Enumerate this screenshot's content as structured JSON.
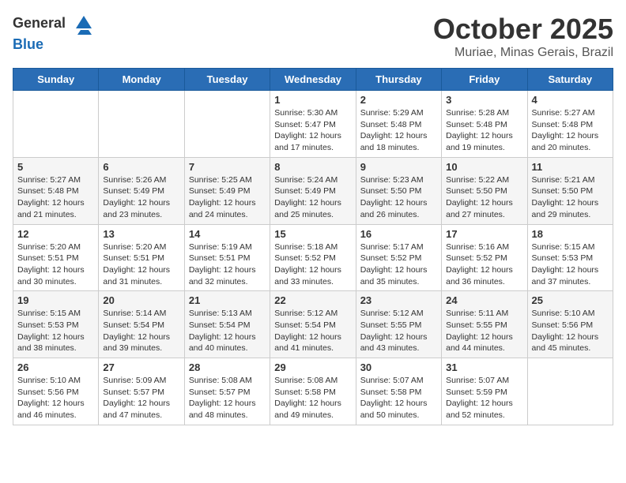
{
  "logo": {
    "general": "General",
    "blue": "Blue"
  },
  "title": "October 2025",
  "location": "Muriae, Minas Gerais, Brazil",
  "days_of_week": [
    "Sunday",
    "Monday",
    "Tuesday",
    "Wednesday",
    "Thursday",
    "Friday",
    "Saturday"
  ],
  "weeks": [
    [
      {
        "day": "",
        "info": ""
      },
      {
        "day": "",
        "info": ""
      },
      {
        "day": "",
        "info": ""
      },
      {
        "day": "1",
        "info": "Sunrise: 5:30 AM\nSunset: 5:47 PM\nDaylight: 12 hours\nand 17 minutes."
      },
      {
        "day": "2",
        "info": "Sunrise: 5:29 AM\nSunset: 5:48 PM\nDaylight: 12 hours\nand 18 minutes."
      },
      {
        "day": "3",
        "info": "Sunrise: 5:28 AM\nSunset: 5:48 PM\nDaylight: 12 hours\nand 19 minutes."
      },
      {
        "day": "4",
        "info": "Sunrise: 5:27 AM\nSunset: 5:48 PM\nDaylight: 12 hours\nand 20 minutes."
      }
    ],
    [
      {
        "day": "5",
        "info": "Sunrise: 5:27 AM\nSunset: 5:48 PM\nDaylight: 12 hours\nand 21 minutes."
      },
      {
        "day": "6",
        "info": "Sunrise: 5:26 AM\nSunset: 5:49 PM\nDaylight: 12 hours\nand 23 minutes."
      },
      {
        "day": "7",
        "info": "Sunrise: 5:25 AM\nSunset: 5:49 PM\nDaylight: 12 hours\nand 24 minutes."
      },
      {
        "day": "8",
        "info": "Sunrise: 5:24 AM\nSunset: 5:49 PM\nDaylight: 12 hours\nand 25 minutes."
      },
      {
        "day": "9",
        "info": "Sunrise: 5:23 AM\nSunset: 5:50 PM\nDaylight: 12 hours\nand 26 minutes."
      },
      {
        "day": "10",
        "info": "Sunrise: 5:22 AM\nSunset: 5:50 PM\nDaylight: 12 hours\nand 27 minutes."
      },
      {
        "day": "11",
        "info": "Sunrise: 5:21 AM\nSunset: 5:50 PM\nDaylight: 12 hours\nand 29 minutes."
      }
    ],
    [
      {
        "day": "12",
        "info": "Sunrise: 5:20 AM\nSunset: 5:51 PM\nDaylight: 12 hours\nand 30 minutes."
      },
      {
        "day": "13",
        "info": "Sunrise: 5:20 AM\nSunset: 5:51 PM\nDaylight: 12 hours\nand 31 minutes."
      },
      {
        "day": "14",
        "info": "Sunrise: 5:19 AM\nSunset: 5:51 PM\nDaylight: 12 hours\nand 32 minutes."
      },
      {
        "day": "15",
        "info": "Sunrise: 5:18 AM\nSunset: 5:52 PM\nDaylight: 12 hours\nand 33 minutes."
      },
      {
        "day": "16",
        "info": "Sunrise: 5:17 AM\nSunset: 5:52 PM\nDaylight: 12 hours\nand 35 minutes."
      },
      {
        "day": "17",
        "info": "Sunrise: 5:16 AM\nSunset: 5:52 PM\nDaylight: 12 hours\nand 36 minutes."
      },
      {
        "day": "18",
        "info": "Sunrise: 5:15 AM\nSunset: 5:53 PM\nDaylight: 12 hours\nand 37 minutes."
      }
    ],
    [
      {
        "day": "19",
        "info": "Sunrise: 5:15 AM\nSunset: 5:53 PM\nDaylight: 12 hours\nand 38 minutes."
      },
      {
        "day": "20",
        "info": "Sunrise: 5:14 AM\nSunset: 5:54 PM\nDaylight: 12 hours\nand 39 minutes."
      },
      {
        "day": "21",
        "info": "Sunrise: 5:13 AM\nSunset: 5:54 PM\nDaylight: 12 hours\nand 40 minutes."
      },
      {
        "day": "22",
        "info": "Sunrise: 5:12 AM\nSunset: 5:54 PM\nDaylight: 12 hours\nand 41 minutes."
      },
      {
        "day": "23",
        "info": "Sunrise: 5:12 AM\nSunset: 5:55 PM\nDaylight: 12 hours\nand 43 minutes."
      },
      {
        "day": "24",
        "info": "Sunrise: 5:11 AM\nSunset: 5:55 PM\nDaylight: 12 hours\nand 44 minutes."
      },
      {
        "day": "25",
        "info": "Sunrise: 5:10 AM\nSunset: 5:56 PM\nDaylight: 12 hours\nand 45 minutes."
      }
    ],
    [
      {
        "day": "26",
        "info": "Sunrise: 5:10 AM\nSunset: 5:56 PM\nDaylight: 12 hours\nand 46 minutes."
      },
      {
        "day": "27",
        "info": "Sunrise: 5:09 AM\nSunset: 5:57 PM\nDaylight: 12 hours\nand 47 minutes."
      },
      {
        "day": "28",
        "info": "Sunrise: 5:08 AM\nSunset: 5:57 PM\nDaylight: 12 hours\nand 48 minutes."
      },
      {
        "day": "29",
        "info": "Sunrise: 5:08 AM\nSunset: 5:58 PM\nDaylight: 12 hours\nand 49 minutes."
      },
      {
        "day": "30",
        "info": "Sunrise: 5:07 AM\nSunset: 5:58 PM\nDaylight: 12 hours\nand 50 minutes."
      },
      {
        "day": "31",
        "info": "Sunrise: 5:07 AM\nSunset: 5:59 PM\nDaylight: 12 hours\nand 52 minutes."
      },
      {
        "day": "",
        "info": ""
      }
    ]
  ]
}
